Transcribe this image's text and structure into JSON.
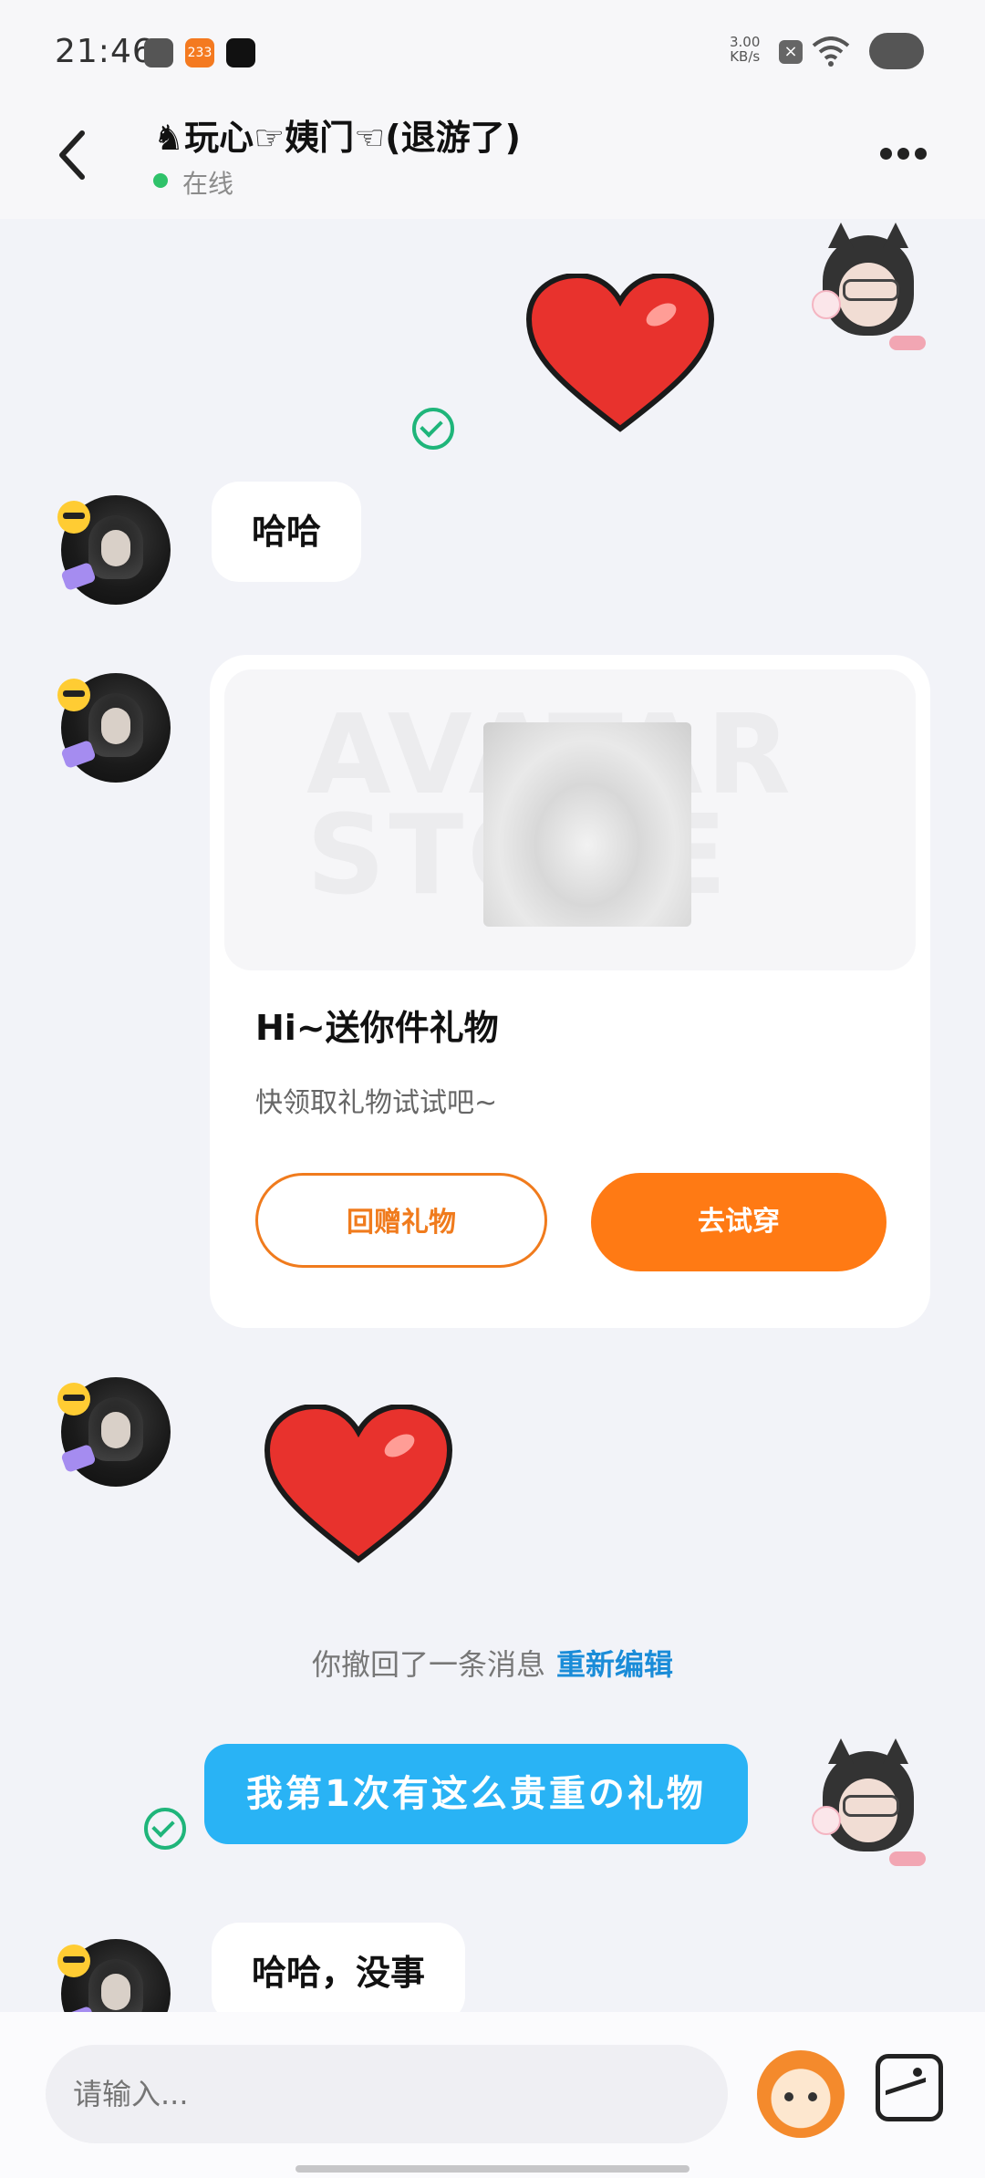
{
  "status_bar": {
    "time": "21:46",
    "net_speed_value": "3.00",
    "net_speed_unit": "KB/s",
    "app_badge": "233",
    "icons": [
      "mask-icon",
      "app-233-icon",
      "tiktok-icon",
      "close-badge-icon",
      "wifi-icon",
      "cloud-icon"
    ]
  },
  "header": {
    "title": "♞玩心☞姨门☜(退游了)",
    "status": "在线",
    "status_color": "#2fc26a"
  },
  "messages": {
    "m1": "哈哈",
    "m2": "哈哈，没事",
    "my_text": "我第1次有这么贵重の礼物"
  },
  "gift_card": {
    "watermark": "AVATAR STORE",
    "title": "Hi~送你件礼物",
    "subtitle": "快领取礼物试试吧~",
    "return_button": "回赠礼物",
    "try_button": "去试穿",
    "accent_color": "#ff7a14"
  },
  "recall_notice": {
    "text": "你撤回了一条消息",
    "edit_label": "重新编辑"
  },
  "input": {
    "placeholder": "请输入..."
  },
  "colors": {
    "my_bubble": "#29b3f5",
    "heart": "#e8322d",
    "read_check": "#1fb57a"
  }
}
